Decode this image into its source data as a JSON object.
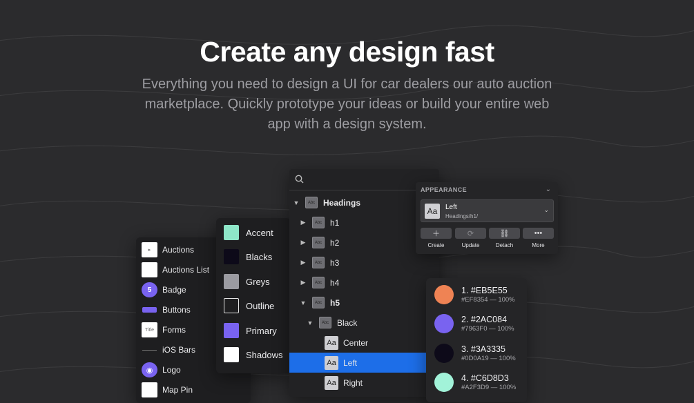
{
  "hero": {
    "title": "Create any design fast",
    "subtitle": "Everything you need to design a UI for car dealers our auto auction marketplace. Quickly prototype your ideas or build your entire web app with a design system."
  },
  "components": {
    "items": [
      {
        "label": "Auctions"
      },
      {
        "label": "Auctions List"
      },
      {
        "label": "Badge",
        "badge": "5"
      },
      {
        "label": "Buttons"
      },
      {
        "label": "Forms",
        "thumb": "Title"
      },
      {
        "label": "iOS Bars"
      },
      {
        "label": "Logo"
      },
      {
        "label": "Map Pin"
      }
    ]
  },
  "styles": {
    "items": [
      {
        "label": "Accent",
        "color": "#8ee6c8"
      },
      {
        "label": "Blacks",
        "color": "#0d0a19"
      },
      {
        "label": "Greys",
        "color": "#9b9ba1"
      },
      {
        "label": "Outline",
        "color": "#1e1e20"
      },
      {
        "label": "Primary",
        "color": "#7963f0"
      },
      {
        "label": "Shadows",
        "color": "#ffffff"
      }
    ]
  },
  "layers": {
    "thumb_text": "Abc",
    "aa_text": "Aa",
    "rows": [
      {
        "label": "Headings",
        "kind": "abc",
        "toggle": "▼",
        "bold": true
      },
      {
        "label": "h1",
        "kind": "abc",
        "toggle": "▶"
      },
      {
        "label": "h2",
        "kind": "abc",
        "toggle": "▶"
      },
      {
        "label": "h3",
        "kind": "abc",
        "toggle": "▶"
      },
      {
        "label": "h4",
        "kind": "abc",
        "toggle": "▶"
      },
      {
        "label": "h5",
        "kind": "abc",
        "toggle": "▼",
        "bold": true
      },
      {
        "label": "Black",
        "kind": "abc",
        "toggle": "▼"
      },
      {
        "label": "Center",
        "kind": "aa"
      },
      {
        "label": "Left",
        "kind": "aa",
        "selected": true
      },
      {
        "label": "Right",
        "kind": "aa"
      }
    ]
  },
  "appearance": {
    "title": "APPEARANCE",
    "style_name": "Left",
    "style_path": "Headings/h1/",
    "aa_text": "Aa",
    "actions": [
      {
        "label": "Create",
        "icon": "plus-icon"
      },
      {
        "label": "Update",
        "icon": "refresh-icon"
      },
      {
        "label": "Detach",
        "icon": "detach-icon"
      },
      {
        "label": "More",
        "icon": "more-icon"
      }
    ]
  },
  "colors": {
    "items": [
      {
        "main": "1. #EB5E55",
        "sub": "#EF8354 — 100%",
        "color": "#ef8354"
      },
      {
        "main": "2. #2AC084",
        "sub": "#7963F0 — 100%",
        "color": "#7963f0"
      },
      {
        "main": "3. #3A3335",
        "sub": "#0D0A19 — 100%",
        "color": "#0d0a19"
      },
      {
        "main": "4. #C6D8D3",
        "sub": "#A2F3D9 — 100%",
        "color": "#a2f3d9"
      }
    ]
  }
}
